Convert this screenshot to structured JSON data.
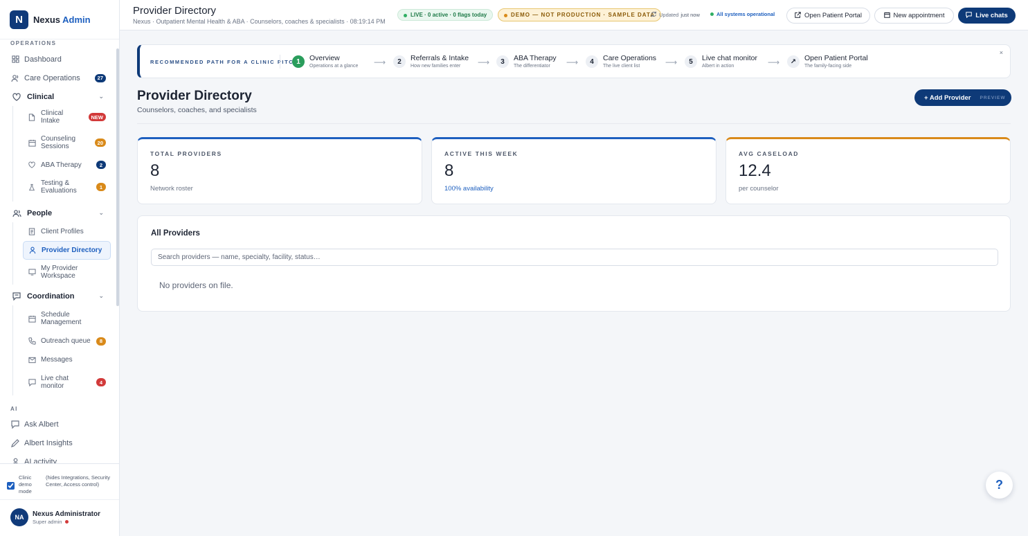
{
  "brand": {
    "logo": "N",
    "name": "Nexus",
    "accent": "Admin"
  },
  "sidebar": {
    "sections": {
      "operations": "OPERATIONS",
      "ai": "AI"
    },
    "top_items": [
      {
        "label": "Dashboard",
        "icon": "grid-icon"
      },
      {
        "label": "Care Operations",
        "icon": "users-icon",
        "badge": "27"
      }
    ],
    "clinical": {
      "label": "Clinical",
      "items": [
        {
          "label": "Clinical Intake",
          "badge": "NEW"
        },
        {
          "label": "Counseling Sessions",
          "badge": "20"
        },
        {
          "label": "ABA Therapy",
          "badge": "2"
        },
        {
          "label": "Testing & Evaluations",
          "badge": "1"
        }
      ]
    },
    "people": {
      "label": "People",
      "items": [
        {
          "label": "Client Profiles"
        },
        {
          "label": "Provider Directory"
        },
        {
          "label": "My Provider Workspace"
        }
      ]
    },
    "coordination": {
      "label": "Coordination",
      "items": [
        {
          "label": "Schedule Management"
        },
        {
          "label": "Outreach queue",
          "badge": "8"
        },
        {
          "label": "Messages"
        },
        {
          "label": "Live chat monitor",
          "badge": "4"
        }
      ]
    },
    "ai_items": [
      {
        "label": "Ask Albert"
      },
      {
        "label": "Albert Insights"
      },
      {
        "label": "AI activity"
      }
    ],
    "footer": {
      "demo_label": "Clinic demo mode",
      "demo_note": "(hides Integrations, Security Center, Access control)",
      "user_initials": "NA",
      "user_name": "Nexus Administrator",
      "user_role": "Super admin"
    }
  },
  "topbar": {
    "title": "Provider Directory",
    "subtitle": "Nexus · Outpatient Mental Health & ABA · Counselors, coaches & specialists · 08:19:14 PM",
    "live_pill": "LIVE · 0 active · 0 flags today",
    "demo_pill": "DEMO — NOT PRODUCTION · SAMPLE DATA",
    "updated_label": "Updated",
    "updated_value": "just now",
    "status": "All systems operational",
    "buttons": {
      "portal": "Open Patient Portal",
      "appointment": "New appointment",
      "chats": "Live chats"
    }
  },
  "path": {
    "label": "RECOMMENDED PATH FOR A CLINIC PITCH",
    "close": "×",
    "steps": [
      {
        "num": "1",
        "title": "Overview",
        "desc": "Operations at a glance"
      },
      {
        "num": "2",
        "title": "Referrals & Intake",
        "desc": "How new families enter"
      },
      {
        "num": "3",
        "title": "ABA Therapy",
        "desc": "The differentiator"
      },
      {
        "num": "4",
        "title": "Care Operations",
        "desc": "The live client list"
      },
      {
        "num": "5",
        "title": "Live chat monitor",
        "desc": "Albert in action"
      },
      {
        "num": "↗",
        "title": "Open Patient Portal",
        "desc": "The family-facing side"
      }
    ]
  },
  "page": {
    "title": "Provider Directory",
    "subtitle": "Counselors, coaches, and specialists",
    "add_button": "+ Add Provider",
    "add_tag": "PREVIEW"
  },
  "stats": [
    {
      "label": "TOTAL PROVIDERS",
      "value": "8",
      "note": "Network roster",
      "color": "#1d5fbf"
    },
    {
      "label": "ACTIVE THIS WEEK",
      "value": "8",
      "note": "100% availability",
      "color": "#1d5fbf"
    },
    {
      "label": "AVG CASELOAD",
      "value": "12.4",
      "note": "per counselor",
      "color": "#d98a1a"
    }
  ],
  "providers": {
    "title": "All Providers",
    "search_placeholder": "Search providers — name, specialty, facility, status…",
    "empty": "No providers on file."
  },
  "help": "?"
}
